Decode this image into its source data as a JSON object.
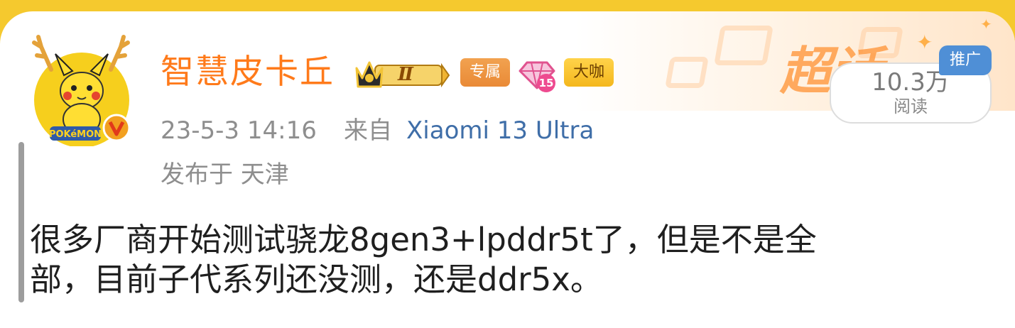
{
  "post": {
    "username": "智慧皮卡丘",
    "badges": {
      "crown": "crown-level-icon",
      "crown_level": "Ⅱ",
      "exclusive": "专属",
      "diamond_level": "15",
      "daka": "大咖"
    },
    "meta": {
      "time": "23-5-3 14:16",
      "from_prefix": "来自",
      "device": "Xiaomi 13 Ultra",
      "location": "发布于 天津"
    },
    "read_count": "10.3万",
    "read_label": "阅读",
    "super_topic": "超话",
    "promo": "推广",
    "content_line1": "很多厂商开始测试骁龙8gen3+lpddr5t了，但是不是全",
    "content_line2": "部，目前子代系列还没测，还是ddr5x。"
  },
  "colors": {
    "top_bar": "#f5c92e",
    "username": "#ff7a1a",
    "device_link": "#3f6ea8",
    "meta_gray": "#8e8e8e",
    "promo_badge": "#4f8fd6"
  },
  "icons": {
    "avatar": "pikachu-avatar",
    "verified": "verified-v-icon",
    "diamond": "diamond-level-icon"
  }
}
